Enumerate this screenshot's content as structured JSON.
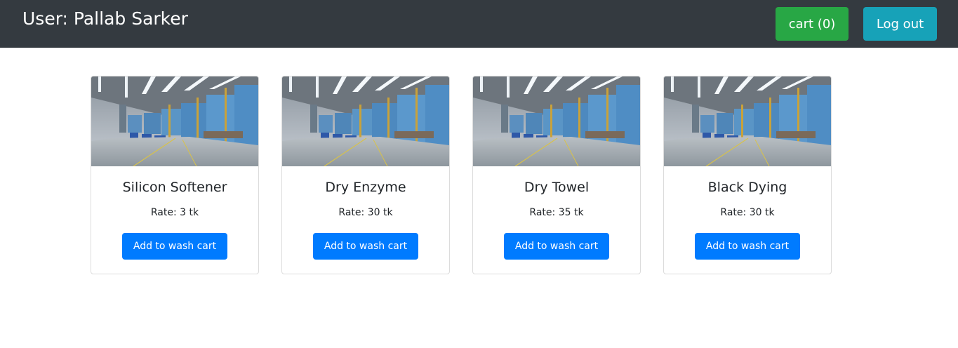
{
  "header": {
    "user_title": "User: Pallab Sarker",
    "cart_label": "cart (0)",
    "logout_label": "Log out"
  },
  "colors": {
    "navbar": "#343a40",
    "cart_button": "#28a745",
    "logout_button": "#17a2b8",
    "add_button": "#007bff"
  },
  "products": [
    {
      "name": "Silicon Softener",
      "rate": "Rate: 3 tk",
      "button": "Add to wash cart",
      "image": "laundry-factory-photo"
    },
    {
      "name": "Dry Enzyme",
      "rate": "Rate: 30 tk",
      "button": "Add to wash cart",
      "image": "laundry-factory-photo"
    },
    {
      "name": "Dry Towel",
      "rate": "Rate: 35 tk",
      "button": "Add to wash cart",
      "image": "laundry-factory-photo"
    },
    {
      "name": "Black Dying",
      "rate": "Rate: 30 tk",
      "button": "Add to wash cart",
      "image": "laundry-factory-photo"
    }
  ]
}
